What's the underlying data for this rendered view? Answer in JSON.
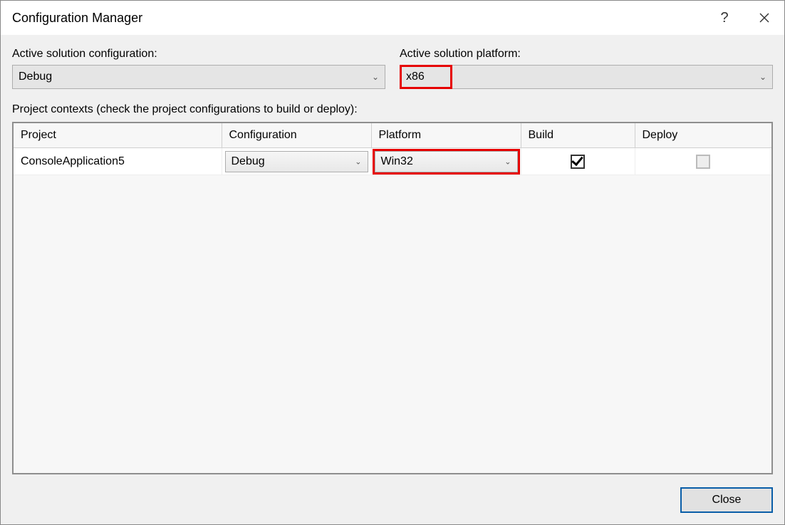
{
  "window": {
    "title": "Configuration Manager"
  },
  "labels": {
    "active_config": "Active solution configuration:",
    "active_platform": "Active solution platform:",
    "contexts": "Project contexts (check the project configurations to build or deploy):"
  },
  "active_config": {
    "value": "Debug"
  },
  "active_platform": {
    "value": "x86"
  },
  "table": {
    "headers": {
      "project": "Project",
      "configuration": "Configuration",
      "platform": "Platform",
      "build": "Build",
      "deploy": "Deploy"
    },
    "row0": {
      "project": "ConsoleApplication5",
      "configuration": "Debug",
      "platform": "Win32",
      "build_checked": true,
      "deploy_enabled": false
    }
  },
  "buttons": {
    "close": "Close"
  }
}
